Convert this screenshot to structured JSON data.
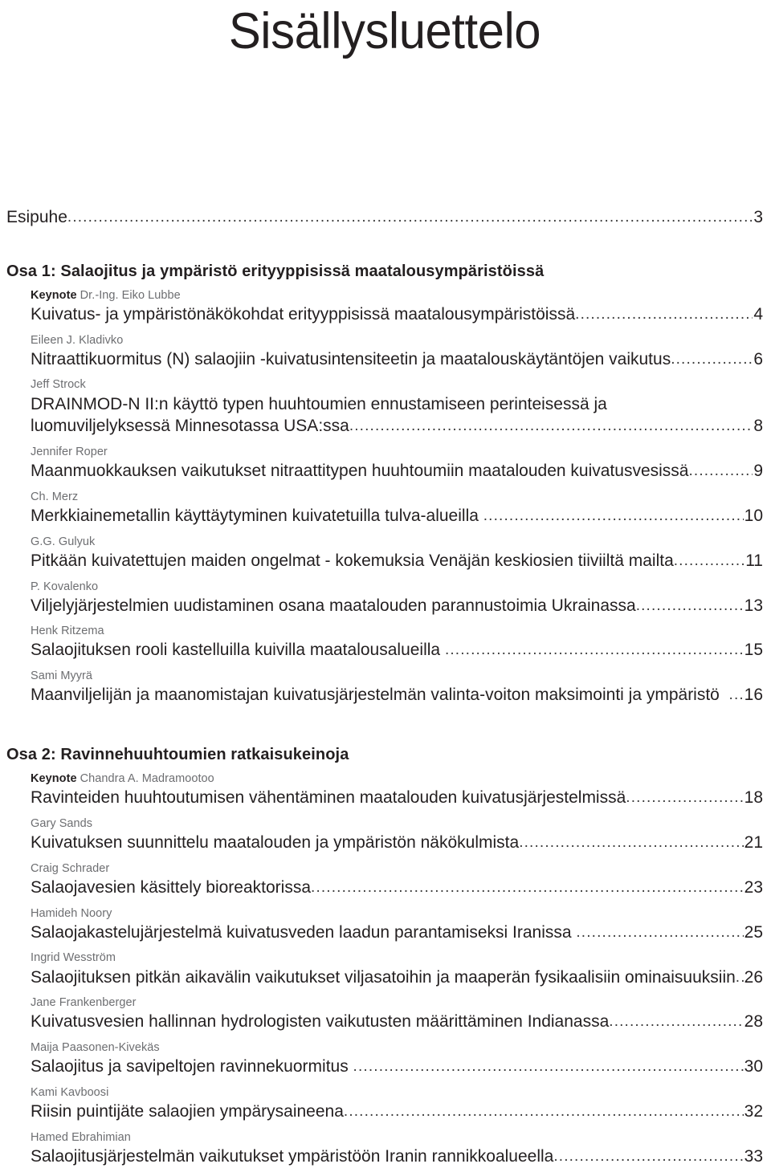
{
  "document": {
    "title": "Sisällysluettelo",
    "leader_char": "."
  },
  "preface": {
    "label": "Esipuhe",
    "page": "3"
  },
  "parts": [
    {
      "heading": "Osa 1: Salaojitus ja ympäristö erityyppisissä maatalousympäristöissä",
      "entries": [
        {
          "keynote_label": "Keynote",
          "author": " Dr.-Ing. Eiko Lubbe",
          "lines": [
            "Kuivatus- ja ympäristönäkökohdat erityyppisissä maatalousympäristöissä"
          ],
          "page": "4"
        },
        {
          "keynote_label": "",
          "author": "Eileen J. Kladivko",
          "lines": [
            "Nitraattikuormitus (N) salaojiin -kuivatusintensiteetin ja maatalouskäytäntöjen vaikutus"
          ],
          "page": "6"
        },
        {
          "keynote_label": "",
          "author": "Jeff Strock",
          "lines": [
            "DRAINMOD-N II:n käyttö typen huuhtoumien ennustamiseen perinteisessä ja",
            "luomuviljelyksessä Minnesotassa USA:ssa"
          ],
          "page": "8"
        },
        {
          "keynote_label": "",
          "author": "Jennifer Roper",
          "lines": [
            "Maanmuokkauksen vaikutukset nitraattitypen huuhtoumiin maatalouden kuivatusvesissä"
          ],
          "page": "9"
        },
        {
          "keynote_label": "",
          "author": "Ch. Merz",
          "lines": [
            "Merkkiainemetallin käyttäytyminen kuivatetuilla tulva-alueilla "
          ],
          "page": "10"
        },
        {
          "keynote_label": "",
          "author": "G.G. Gulyuk",
          "lines": [
            "Pitkään kuivatettujen maiden ongelmat - kokemuksia Venäjän keskiosien tiiviiltä mailta"
          ],
          "page": "11"
        },
        {
          "keynote_label": "",
          "author": "P. Kovalenko",
          "lines": [
            "Viljelyjärjestelmien uudistaminen osana maatalouden parannustoimia Ukrainassa"
          ],
          "page": "13"
        },
        {
          "keynote_label": "",
          "author": "Henk Ritzema",
          "lines": [
            "Salaojituksen rooli kastelluilla kuivilla maatalousalueilla "
          ],
          "page": "15"
        },
        {
          "keynote_label": "",
          "author": "Sami Myyrä",
          "lines": [
            "Maanviljelijän ja maanomistajan kuivatusjärjestelmän valinta-voiton maksimointi ja ympäristö  "
          ],
          "page": "16"
        }
      ]
    },
    {
      "heading": "Osa 2: Ravinnehuuhtoumien ratkaisukeinoja",
      "entries": [
        {
          "keynote_label": "Keynote",
          "author": " Chandra A. Madramootoo",
          "lines": [
            "Ravinteiden huuhtoutumisen vähentäminen maatalouden kuivatusjärjestelmissä"
          ],
          "page": "18"
        },
        {
          "keynote_label": "",
          "author": "Gary Sands",
          "lines": [
            "Kuivatuksen suunnittelu maatalouden ja ympäristön näkökulmista"
          ],
          "page": "21"
        },
        {
          "keynote_label": "",
          "author": "Craig Schrader",
          "lines": [
            "Salaojavesien käsittely bioreaktorissa"
          ],
          "page": "23"
        },
        {
          "keynote_label": "",
          "author": "Hamideh Noory",
          "lines": [
            "Salaojakastelujärjestelmä kuivatusveden laadun parantamiseksi Iranissa "
          ],
          "page": "25"
        },
        {
          "keynote_label": "",
          "author": "Ingrid Wesström",
          "lines": [
            "Salaojituksen pitkän aikavälin vaikutukset viljasatoihin ja maaperän fysikaalisiin ominaisuuksiin"
          ],
          "page": "26"
        },
        {
          "keynote_label": "",
          "author": "Jane Frankenberger",
          "lines": [
            "Kuivatusvesien hallinnan hydrologisten vaikutusten määrittäminen Indianassa"
          ],
          "page": "28"
        },
        {
          "keynote_label": "",
          "author": "Maija Paasonen-Kivekäs",
          "lines": [
            "Salaojitus ja savipeltojen ravinnekuormitus "
          ],
          "page": "30"
        },
        {
          "keynote_label": "",
          "author": "Kami Kavboosi",
          "lines": [
            "Riisin puintijäte salaojien ympärysaineena"
          ],
          "page": "32"
        },
        {
          "keynote_label": "",
          "author": "Hamed Ebrahimian",
          "lines": [
            "Salaojitusjärjestelmän vaikutukset ympäristöön Iranin rannikkoalueella"
          ],
          "page": "33"
        }
      ]
    }
  ]
}
